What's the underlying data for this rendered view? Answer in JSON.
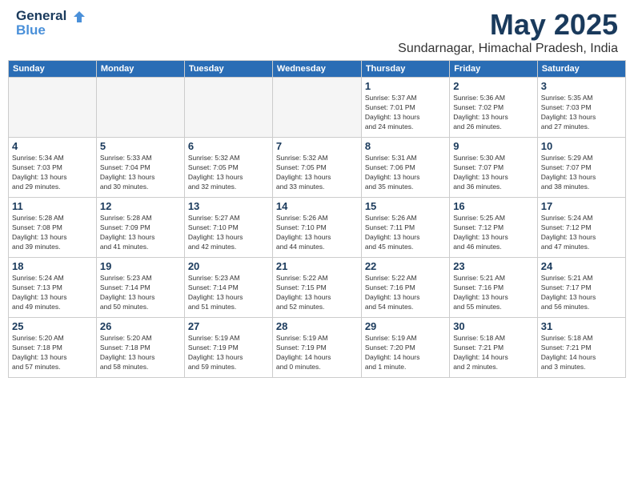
{
  "header": {
    "logo_line1": "General",
    "logo_line2": "Blue",
    "month": "May 2025",
    "location": "Sundarnagar, Himachal Pradesh, India"
  },
  "days_of_week": [
    "Sunday",
    "Monday",
    "Tuesday",
    "Wednesday",
    "Thursday",
    "Friday",
    "Saturday"
  ],
  "weeks": [
    [
      {
        "day": "",
        "info": "",
        "empty": true
      },
      {
        "day": "",
        "info": "",
        "empty": true
      },
      {
        "day": "",
        "info": "",
        "empty": true
      },
      {
        "day": "",
        "info": "",
        "empty": true
      },
      {
        "day": "1",
        "info": "Sunrise: 5:37 AM\nSunset: 7:01 PM\nDaylight: 13 hours\nand 24 minutes."
      },
      {
        "day": "2",
        "info": "Sunrise: 5:36 AM\nSunset: 7:02 PM\nDaylight: 13 hours\nand 26 minutes."
      },
      {
        "day": "3",
        "info": "Sunrise: 5:35 AM\nSunset: 7:03 PM\nDaylight: 13 hours\nand 27 minutes."
      }
    ],
    [
      {
        "day": "4",
        "info": "Sunrise: 5:34 AM\nSunset: 7:03 PM\nDaylight: 13 hours\nand 29 minutes."
      },
      {
        "day": "5",
        "info": "Sunrise: 5:33 AM\nSunset: 7:04 PM\nDaylight: 13 hours\nand 30 minutes."
      },
      {
        "day": "6",
        "info": "Sunrise: 5:32 AM\nSunset: 7:05 PM\nDaylight: 13 hours\nand 32 minutes."
      },
      {
        "day": "7",
        "info": "Sunrise: 5:32 AM\nSunset: 7:05 PM\nDaylight: 13 hours\nand 33 minutes."
      },
      {
        "day": "8",
        "info": "Sunrise: 5:31 AM\nSunset: 7:06 PM\nDaylight: 13 hours\nand 35 minutes."
      },
      {
        "day": "9",
        "info": "Sunrise: 5:30 AM\nSunset: 7:07 PM\nDaylight: 13 hours\nand 36 minutes."
      },
      {
        "day": "10",
        "info": "Sunrise: 5:29 AM\nSunset: 7:07 PM\nDaylight: 13 hours\nand 38 minutes."
      }
    ],
    [
      {
        "day": "11",
        "info": "Sunrise: 5:28 AM\nSunset: 7:08 PM\nDaylight: 13 hours\nand 39 minutes."
      },
      {
        "day": "12",
        "info": "Sunrise: 5:28 AM\nSunset: 7:09 PM\nDaylight: 13 hours\nand 41 minutes."
      },
      {
        "day": "13",
        "info": "Sunrise: 5:27 AM\nSunset: 7:10 PM\nDaylight: 13 hours\nand 42 minutes."
      },
      {
        "day": "14",
        "info": "Sunrise: 5:26 AM\nSunset: 7:10 PM\nDaylight: 13 hours\nand 44 minutes."
      },
      {
        "day": "15",
        "info": "Sunrise: 5:26 AM\nSunset: 7:11 PM\nDaylight: 13 hours\nand 45 minutes."
      },
      {
        "day": "16",
        "info": "Sunrise: 5:25 AM\nSunset: 7:12 PM\nDaylight: 13 hours\nand 46 minutes."
      },
      {
        "day": "17",
        "info": "Sunrise: 5:24 AM\nSunset: 7:12 PM\nDaylight: 13 hours\nand 47 minutes."
      }
    ],
    [
      {
        "day": "18",
        "info": "Sunrise: 5:24 AM\nSunset: 7:13 PM\nDaylight: 13 hours\nand 49 minutes."
      },
      {
        "day": "19",
        "info": "Sunrise: 5:23 AM\nSunset: 7:14 PM\nDaylight: 13 hours\nand 50 minutes."
      },
      {
        "day": "20",
        "info": "Sunrise: 5:23 AM\nSunset: 7:14 PM\nDaylight: 13 hours\nand 51 minutes."
      },
      {
        "day": "21",
        "info": "Sunrise: 5:22 AM\nSunset: 7:15 PM\nDaylight: 13 hours\nand 52 minutes."
      },
      {
        "day": "22",
        "info": "Sunrise: 5:22 AM\nSunset: 7:16 PM\nDaylight: 13 hours\nand 54 minutes."
      },
      {
        "day": "23",
        "info": "Sunrise: 5:21 AM\nSunset: 7:16 PM\nDaylight: 13 hours\nand 55 minutes."
      },
      {
        "day": "24",
        "info": "Sunrise: 5:21 AM\nSunset: 7:17 PM\nDaylight: 13 hours\nand 56 minutes."
      }
    ],
    [
      {
        "day": "25",
        "info": "Sunrise: 5:20 AM\nSunset: 7:18 PM\nDaylight: 13 hours\nand 57 minutes."
      },
      {
        "day": "26",
        "info": "Sunrise: 5:20 AM\nSunset: 7:18 PM\nDaylight: 13 hours\nand 58 minutes."
      },
      {
        "day": "27",
        "info": "Sunrise: 5:19 AM\nSunset: 7:19 PM\nDaylight: 13 hours\nand 59 minutes."
      },
      {
        "day": "28",
        "info": "Sunrise: 5:19 AM\nSunset: 7:19 PM\nDaylight: 14 hours\nand 0 minutes."
      },
      {
        "day": "29",
        "info": "Sunrise: 5:19 AM\nSunset: 7:20 PM\nDaylight: 14 hours\nand 1 minute."
      },
      {
        "day": "30",
        "info": "Sunrise: 5:18 AM\nSunset: 7:21 PM\nDaylight: 14 hours\nand 2 minutes."
      },
      {
        "day": "31",
        "info": "Sunrise: 5:18 AM\nSunset: 7:21 PM\nDaylight: 14 hours\nand 3 minutes."
      }
    ]
  ]
}
